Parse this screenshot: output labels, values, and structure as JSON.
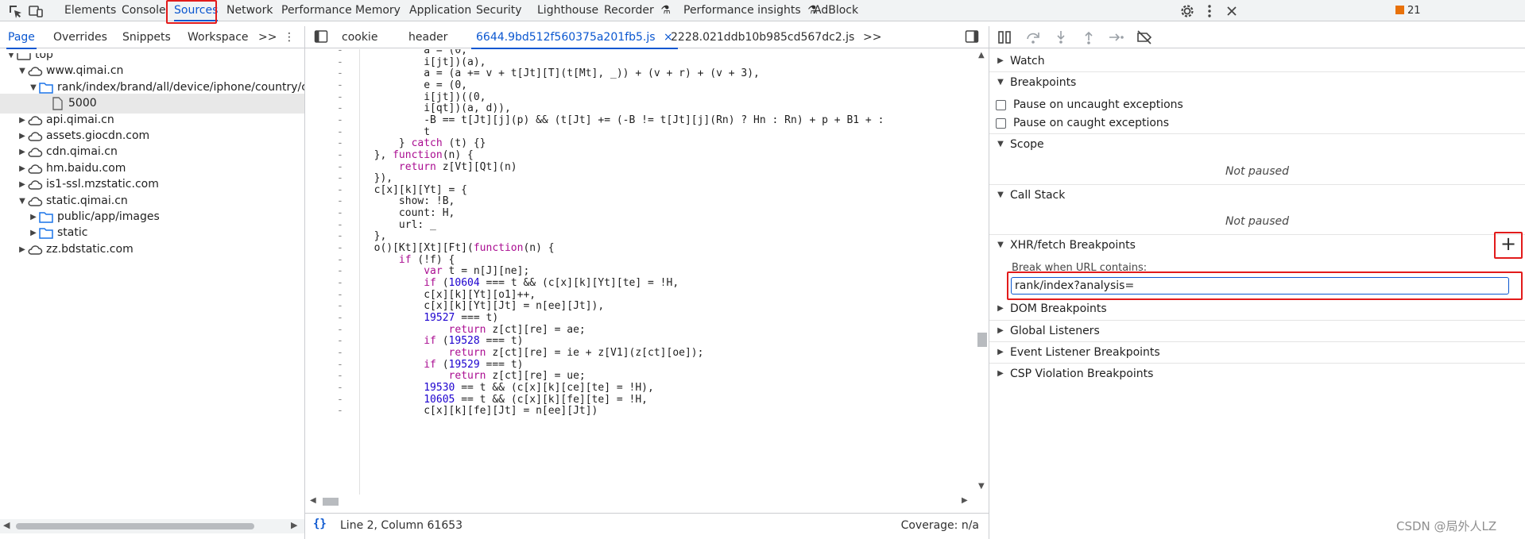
{
  "toolbar": {
    "tabs": [
      "Elements",
      "Console",
      "Sources",
      "Network",
      "Performance",
      "Memory",
      "Application",
      "Security",
      "Lighthouse",
      "Recorder",
      "Performance insights",
      "AdBlock"
    ],
    "active_tab": "Sources",
    "issues_count": "21"
  },
  "navigator": {
    "tabs": [
      "Page",
      "Overrides",
      "Snippets",
      "Workspace"
    ],
    "more": ">>",
    "tree": [
      {
        "label": "top",
        "depth": 0,
        "expanded": true,
        "type": "frame"
      },
      {
        "label": "www.qimai.cn",
        "depth": 1,
        "expanded": true,
        "type": "cloud"
      },
      {
        "label": "rank/index/brand/all/device/iphone/country/c",
        "depth": 2,
        "expanded": true,
        "type": "folder"
      },
      {
        "label": "5000",
        "depth": 3,
        "expanded": null,
        "type": "file",
        "selected": true
      },
      {
        "label": "api.qimai.cn",
        "depth": 1,
        "expanded": false,
        "type": "cloud"
      },
      {
        "label": "assets.giocdn.com",
        "depth": 1,
        "expanded": false,
        "type": "cloud"
      },
      {
        "label": "cdn.qimai.cn",
        "depth": 1,
        "expanded": false,
        "type": "cloud"
      },
      {
        "label": "hm.baidu.com",
        "depth": 1,
        "expanded": false,
        "type": "cloud"
      },
      {
        "label": "is1-ssl.mzstatic.com",
        "depth": 1,
        "expanded": false,
        "type": "cloud"
      },
      {
        "label": "static.qimai.cn",
        "depth": 1,
        "expanded": true,
        "type": "cloud"
      },
      {
        "label": "public/app/images",
        "depth": 2,
        "expanded": false,
        "type": "folder"
      },
      {
        "label": "static",
        "depth": 2,
        "expanded": false,
        "type": "folder"
      },
      {
        "label": "zz.bdstatic.com",
        "depth": 1,
        "expanded": false,
        "type": "cloud"
      }
    ]
  },
  "editor": {
    "tabs": [
      "cookie",
      "header",
      "6644.9bd512f560375a201fb5.js",
      "2228.021ddb10b985cd567dc2.js"
    ],
    "active_tab": "6644.9bd512f560375a201fb5.js",
    "close_glyph": "×",
    "more": ">>",
    "gutter_mark": "-",
    "code_lines": [
      "                a = (0,",
      "                i[jt])(a),",
      "                a = (a += v + t[Jt][T](t[Mt], _)) + (v + r) + (v + 3),",
      "                e = (0,",
      "                i[jt])((0,",
      "                i[qt])(a, d)),",
      "                -B == t[Jt][j](p) && (t[Jt] += (-B != t[Jt][j](Rn) ? Hn : Rn) + p + B1 + :",
      "                t",
      "            } catch (t) {}",
      "        }, function(n) {",
      "            return z[Vt][Qt](n)",
      "        }),",
      "        c[x][k][Yt] = {",
      "            show: !B,",
      "            count: H,",
      "            url: _",
      "        },",
      "        o()[Kt][Xt][Ft](function(n) {",
      "            if (!f) {",
      "                var t = n[J][ne];",
      "                if (10604 === t && (c[x][k][Yt][te] = !H,",
      "                c[x][k][Yt][o1]++,",
      "                c[x][k][Yt][Jt] = n[ee][Jt]),",
      "                19527 === t)",
      "                    return z[ct][re] = ae;",
      "                if (19528 === t)",
      "                    return z[ct][re] = ie + z[V1](z[ct][oe]);",
      "                if (19529 === t)",
      "                    return z[ct][re] = ue;",
      "                19530 == t && (c[x][k][ce][te] = !H),",
      "                10605 == t && (c[x][k][fe][te] = !H,",
      "                c[x][k][fe][Jt] = n[ee][Jt])"
    ],
    "status_braces": "{}",
    "cursor_position": "Line 2, Column 61653",
    "coverage": "Coverage: n/a"
  },
  "debugger": {
    "watch_label": "Watch",
    "breakpoints_label": "Breakpoints",
    "pause_uncaught": "Pause on uncaught exceptions",
    "pause_caught": "Pause on caught exceptions",
    "scope_label": "Scope",
    "scope_status": "Not paused",
    "callstack_label": "Call Stack",
    "callstack_status": "Not paused",
    "xhr_label": "XHR/fetch Breakpoints",
    "xhr_add": "+",
    "xhr_prompt": "Break when URL contains:",
    "xhr_value": "rank/index?analysis=",
    "dom_label": "DOM Breakpoints",
    "global_label": "Global Listeners",
    "event_label": "Event Listener Breakpoints",
    "csp_label": "CSP Violation Breakpoints"
  },
  "watermark": "CSDN @局外人LZ"
}
